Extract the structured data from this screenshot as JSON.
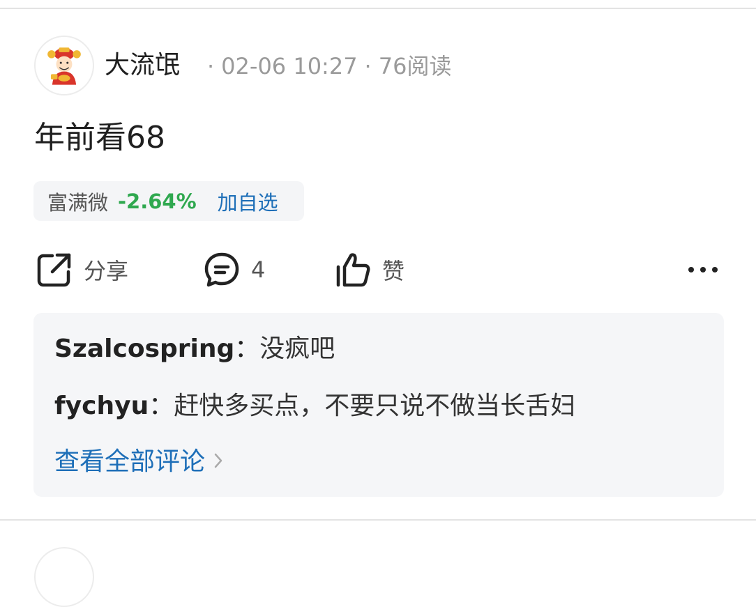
{
  "post": {
    "author": "大流氓",
    "time": "02-06 10:27",
    "reads": "76阅读",
    "separator": "·",
    "content": "年前看68"
  },
  "stock": {
    "name": "富满微",
    "change": "-2.64%",
    "add_label": "加自选",
    "change_color": "#2fa84f",
    "link_color": "#1e6fb8"
  },
  "actions": {
    "share_label": "分享",
    "comment_count": "4",
    "like_label": "赞",
    "icons": [
      "share-icon",
      "comment-icon",
      "thumbs-up-icon",
      "more-icon"
    ]
  },
  "comments": [
    {
      "user": "Szalcospring",
      "text": "没疯吧"
    },
    {
      "user": "fychyu",
      "text": "赶快多买点，不要只说不做当长舌妇"
    }
  ],
  "colon": "：",
  "view_all_label": "查看全部评论"
}
